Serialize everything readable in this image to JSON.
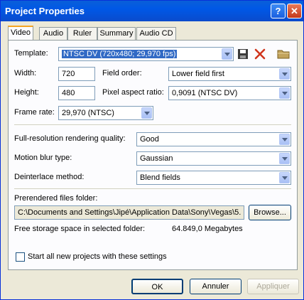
{
  "window": {
    "title": "Project Properties",
    "help_label": "?",
    "close_label": "✕"
  },
  "tabs": [
    {
      "label": "Video"
    },
    {
      "label": "Audio"
    },
    {
      "label": "Ruler"
    },
    {
      "label": "Summary"
    },
    {
      "label": "Audio CD"
    }
  ],
  "video": {
    "template_label": "Template:",
    "template_value": "NTSC DV (720x480; 29,970 fps)",
    "width_label": "Width:",
    "width_value": "720",
    "height_label": "Height:",
    "height_value": "480",
    "field_order_label": "Field order:",
    "field_order_value": "Lower field first",
    "pixel_aspect_label": "Pixel aspect ratio:",
    "pixel_aspect_value": "0,9091 (NTSC DV)",
    "frame_rate_label": "Frame rate:",
    "frame_rate_value": "29,970 (NTSC)",
    "render_quality_label": "Full-resolution rendering quality:",
    "render_quality_value": "Good",
    "motion_blur_label": "Motion blur type:",
    "motion_blur_value": "Gaussian",
    "deinterlace_label": "Deinterlace method:",
    "deinterlace_value": "Blend fields",
    "prerendered_label": "Prerendered files folder:",
    "prerendered_value": "C:\\Documents and Settings\\Jipé\\Application Data\\Sony\\Vegas\\5.",
    "browse_label": "Browse...",
    "free_space_label": "Free storage space in selected folder:",
    "free_space_value": "64.849,0 Megabytes",
    "start_all_label": "Start all new projects with these settings",
    "start_all_checked": false
  },
  "buttons": {
    "ok": "OK",
    "cancel": "Annuler",
    "apply": "Appliquer"
  },
  "icons": {
    "save": "save-icon",
    "delete": "delete-icon",
    "folder": "folder-icon"
  },
  "colors": {
    "accent": "#316ac5",
    "titlebar": "#0058e6",
    "tab_highlight": "#f5a623"
  }
}
